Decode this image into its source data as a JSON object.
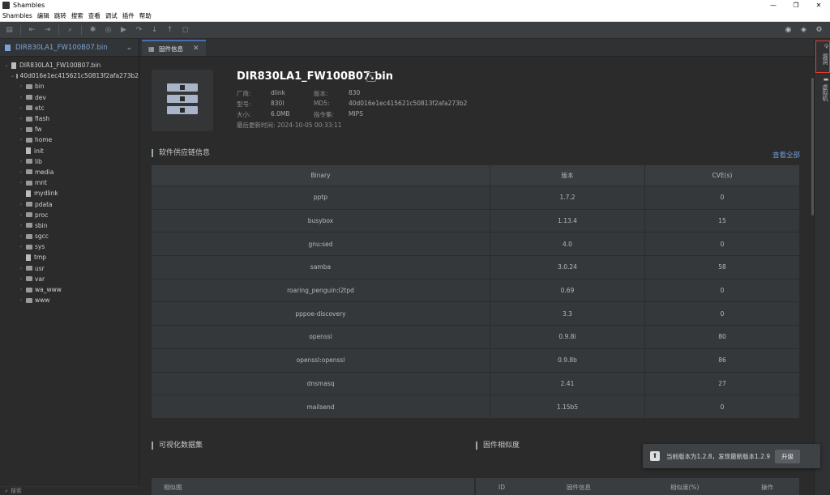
{
  "window": {
    "title": "Shambles"
  },
  "menu": [
    "Shambles",
    "编辑",
    "跳转",
    "搜索",
    "查看",
    "调试",
    "插件",
    "帮助"
  ],
  "sidebar": {
    "header": "DIR830LA1_FW100B07.bin",
    "tree": [
      {
        "label": "DIR830LA1_FW100B07.bin",
        "kind": "file",
        "level": 0,
        "arrow": "⌄"
      },
      {
        "label": "40d016e1ec415621c50813f2afa273b2",
        "kind": "folder",
        "level": 1,
        "arrow": "⌄"
      },
      {
        "label": "bin",
        "kind": "folder",
        "level": 2,
        "arrow": "›"
      },
      {
        "label": "dev",
        "kind": "folder",
        "level": 2,
        "arrow": "›"
      },
      {
        "label": "etc",
        "kind": "folder",
        "level": 2,
        "arrow": "›"
      },
      {
        "label": "flash",
        "kind": "folder",
        "level": 2,
        "arrow": "›"
      },
      {
        "label": "fw",
        "kind": "folder",
        "level": 2,
        "arrow": "›"
      },
      {
        "label": "home",
        "kind": "folder",
        "level": 2,
        "arrow": "›"
      },
      {
        "label": "init",
        "kind": "file",
        "level": 2,
        "arrow": ""
      },
      {
        "label": "lib",
        "kind": "folder",
        "level": 2,
        "arrow": "›"
      },
      {
        "label": "media",
        "kind": "folder",
        "level": 2,
        "arrow": "›"
      },
      {
        "label": "mnt",
        "kind": "folder",
        "level": 2,
        "arrow": "›"
      },
      {
        "label": "mydlink",
        "kind": "file",
        "level": 2,
        "arrow": ""
      },
      {
        "label": "pdata",
        "kind": "folder",
        "level": 2,
        "arrow": "›"
      },
      {
        "label": "proc",
        "kind": "folder",
        "level": 2,
        "arrow": "›"
      },
      {
        "label": "sbin",
        "kind": "folder",
        "level": 2,
        "arrow": "›"
      },
      {
        "label": "sgcc",
        "kind": "folder",
        "level": 2,
        "arrow": "›"
      },
      {
        "label": "sys",
        "kind": "folder",
        "level": 2,
        "arrow": "›"
      },
      {
        "label": "tmp",
        "kind": "file",
        "level": 2,
        "arrow": ""
      },
      {
        "label": "usr",
        "kind": "folder",
        "level": 2,
        "arrow": "›"
      },
      {
        "label": "var",
        "kind": "folder",
        "level": 2,
        "arrow": "›"
      },
      {
        "label": "wa_www",
        "kind": "folder",
        "level": 2,
        "arrow": "›"
      },
      {
        "label": "www",
        "kind": "folder",
        "level": 2,
        "arrow": "›"
      }
    ],
    "search_placeholder": "搜索"
  },
  "tab": {
    "label": "固件信息"
  },
  "firmware": {
    "title": "DIR830LA1_FW100B07.bin",
    "vendor_label": "厂商:",
    "vendor": "dlink",
    "version_label": "版本:",
    "version": "830",
    "model_label": "型号:",
    "model": "830l",
    "md5_label": "MD5:",
    "md5": "40d016e1ec415621c50813f2afa273b2",
    "size_label": "大小:",
    "size": "6.0MB",
    "arch_label": "指令集:",
    "arch": "MIPS",
    "updated": "最后更新时间: 2024-10-05 00:33:11"
  },
  "supply_chain": {
    "title": "软件供应链信息",
    "view_all": "查看全部",
    "headers": [
      "Binary",
      "版本",
      "CVE(s)"
    ],
    "rows": [
      [
        "pptp",
        "1.7.2",
        "0"
      ],
      [
        "busybox",
        "1.13.4",
        "15"
      ],
      [
        "gnu:sed",
        "4.0",
        "0"
      ],
      [
        "samba",
        "3.0.24",
        "58"
      ],
      [
        "roaring_penguin:l2tpd",
        "0.69",
        "0"
      ],
      [
        "pppoe-discovery",
        "3.3",
        "0"
      ],
      [
        "openssl",
        "0.9.8i",
        "80"
      ],
      [
        "openssl:openssl",
        "0.9.8b",
        "86"
      ],
      [
        "dnsmasq",
        "2.41",
        "27"
      ],
      [
        "mailsend",
        "1.15b5",
        "0"
      ]
    ]
  },
  "viz": {
    "title": "可视化数据集",
    "header": "相似图"
  },
  "similarity": {
    "title": "固件相似度",
    "headers": [
      "ID",
      "固件信息",
      "相似度(%)",
      "操作"
    ]
  },
  "rail": {
    "item1": "漏洞",
    "item2": "虚拟机"
  },
  "toast": {
    "message": "当前版本为1.2.8，发现最新版本1.2.9",
    "button": "升级"
  }
}
